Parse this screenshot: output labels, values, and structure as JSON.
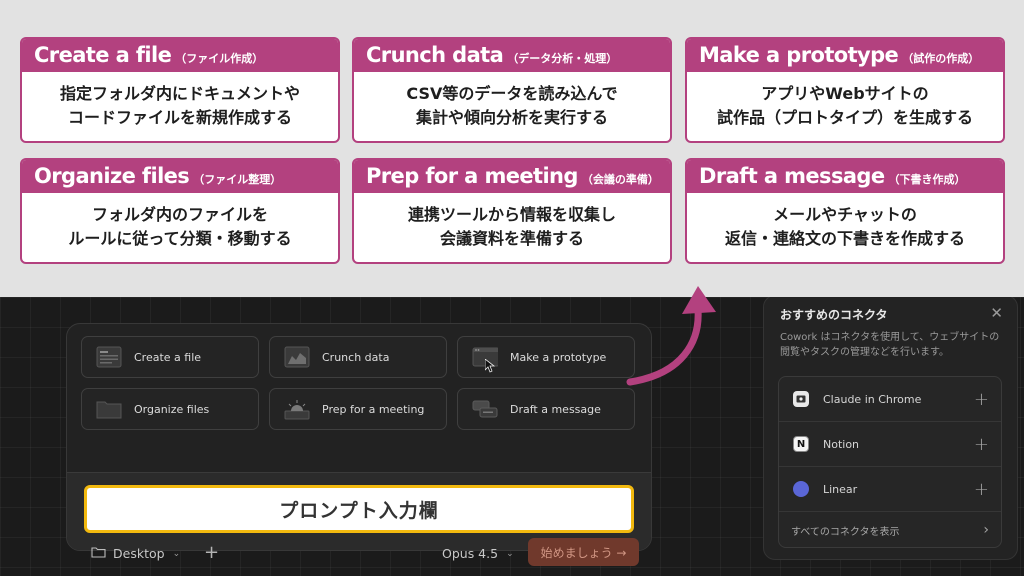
{
  "cards": [
    {
      "title": "Create a file",
      "sub": "（ファイル作成）",
      "lines": [
        "指定フォルダ内にドキュメントや",
        "コードファイルを新規作成する"
      ]
    },
    {
      "title": "Crunch data",
      "sub": "（データ分析・処理）",
      "lines": [
        "CSV等のデータを読み込んで",
        "集計や傾向分析を実行する"
      ]
    },
    {
      "title": "Make a prototype",
      "sub": "（試作の作成）",
      "lines": [
        "アプリやWebサイトの",
        "試作品（プロトタイプ）を生成する"
      ]
    },
    {
      "title": "Organize files",
      "sub": "（ファイル整理）",
      "lines": [
        "フォルダ内のファイルを",
        "ルールに従って分類・移動する"
      ]
    },
    {
      "title": "Prep for a meeting",
      "sub": "（会議の準備）",
      "lines": [
        "連携ツールから情報を収集し",
        "会議資料を準備する"
      ]
    },
    {
      "title": "Draft a message",
      "sub": "（下書き作成）",
      "lines": [
        "メールやチャットの",
        "返信・連絡文の下書きを作成する"
      ]
    }
  ],
  "tasks": [
    {
      "label": "Create a file",
      "icon": "document-icon"
    },
    {
      "label": "Crunch data",
      "icon": "chart-icon"
    },
    {
      "label": "Make a prototype",
      "icon": "browser-window-icon"
    },
    {
      "label": "Organize files",
      "icon": "folder-icon"
    },
    {
      "label": "Prep for a meeting",
      "icon": "sunrise-icon"
    },
    {
      "label": "Draft a message",
      "icon": "chat-bubbles-icon"
    }
  ],
  "prompt": {
    "placeholder": "プロンプト入力欄"
  },
  "toolbar": {
    "folder_label": "Desktop",
    "model_label": "Opus 4.5",
    "start_label": "始めましょう →"
  },
  "side_panel": {
    "title": "おすすめのコネクタ",
    "description": "Cowork はコネクタを使用して、ウェブサイトの閲覧やタスクの管理などを行います。",
    "connectors": [
      {
        "label": "Claude in Chrome",
        "icon": "chrome-icon"
      },
      {
        "label": "Notion",
        "icon": "notion-icon"
      },
      {
        "label": "Linear",
        "icon": "linear-icon"
      }
    ],
    "view_all": "すべてのコネクタを表示"
  },
  "colors": {
    "accent": "#b3417f",
    "prompt_border": "#f2b90f",
    "start_button": "#70392c"
  }
}
